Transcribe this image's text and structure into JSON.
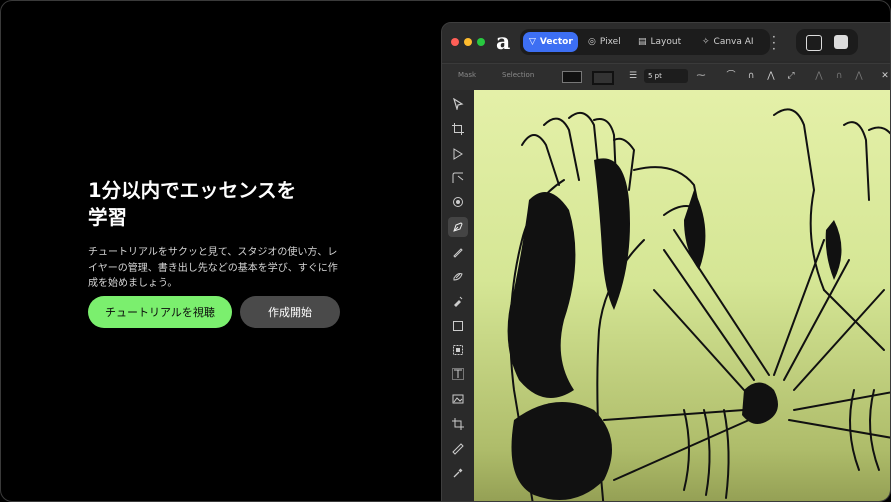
{
  "hero": {
    "title_line1": "1分以内でエッセンスを",
    "title_line2": "学習",
    "description": "チュートリアルをサクッと見て、スタジオの使い方、レイヤーの管理、書き出し先などの基本を学び、すぐに作成を始めましょう。",
    "primary_button": "チュートリアルを視聴",
    "secondary_button": "作成開始"
  },
  "app": {
    "logo": "a",
    "personas": [
      {
        "label": "Vector",
        "icon": "vector-persona-icon",
        "active": true
      },
      {
        "label": "Pixel",
        "icon": "pixel-persona-icon",
        "active": false
      },
      {
        "label": "Layout",
        "icon": "layout-persona-icon",
        "active": false
      },
      {
        "label": "Canva AI",
        "icon": "canva-ai-icon",
        "active": false
      }
    ],
    "context_bar": {
      "mask_label": "Mask",
      "selection_label": "Selection",
      "stroke_width": "5 pt"
    },
    "tools": [
      "move-tool-icon",
      "artboard-tool-icon",
      "node-tool-icon",
      "corner-tool-icon",
      "shape-builder-icon",
      "pen-tool-icon",
      "pencil-tool-icon",
      "brush-tool-icon",
      "fill-tool-icon",
      "transparency-tool-icon",
      "rectangle-tool-icon",
      "frame-tool-icon",
      "text-frame-tool-icon",
      "place-image-icon",
      "crop-tool-icon",
      "ruler-tool-icon",
      "eyedropper-tool-icon"
    ],
    "selected_tool_index": 5
  },
  "colors": {
    "accent_green": "#7bef6e",
    "persona_blue": "#3d6ff3",
    "canvas_yellow": "#e4f0a8"
  }
}
